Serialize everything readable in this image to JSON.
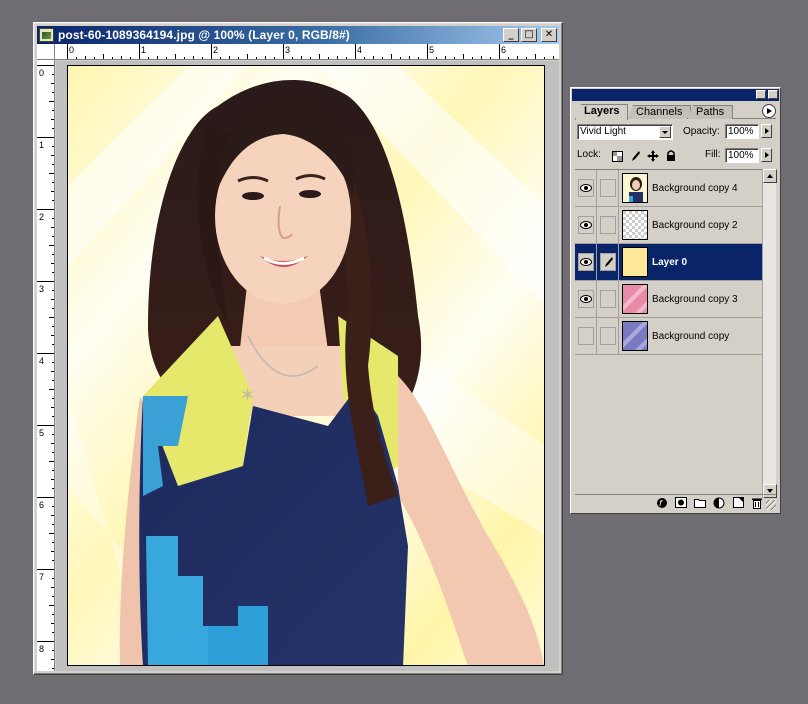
{
  "document_window": {
    "title": "post-60-1089364194.jpg @ 100% (Layer 0, RGB/8#)",
    "buttons": {
      "minimize": "_",
      "maximize": "□",
      "close": "✕"
    },
    "ruler_top_labels": [
      "0",
      "1",
      "2",
      "3",
      "4",
      "5",
      "6"
    ],
    "ruler_left_labels": [
      "0",
      "1",
      "2",
      "3",
      "4",
      "5",
      "6",
      "7",
      "8"
    ]
  },
  "layers_palette": {
    "tabs": [
      "Layers",
      "Channels",
      "Paths"
    ],
    "blend_mode": "Vivid Light",
    "opacity_label": "Opacity:",
    "opacity_value": "100%",
    "lock_label": "Lock:",
    "fill_label": "Fill:",
    "fill_value": "100%",
    "layers": [
      {
        "name": "Background copy 4",
        "visible": true,
        "thumb": "portrait"
      },
      {
        "name": "Background copy 2",
        "visible": true,
        "thumb": "transparent"
      },
      {
        "name": "Layer 0",
        "visible": true,
        "thumb": "yellow",
        "selected": true
      },
      {
        "name": "Background copy 3",
        "visible": true,
        "thumb": "pink"
      },
      {
        "name": "Background copy",
        "visible": false,
        "thumb": "purple"
      }
    ],
    "bottom_icons": [
      "layer-style-icon",
      "mask-icon",
      "group-icon",
      "adjustment-icon",
      "new-layer-icon",
      "trash-icon"
    ]
  },
  "colors": {
    "title_bar": "#0a246a",
    "selection": "#0a246a",
    "background": "#6f6c72"
  }
}
